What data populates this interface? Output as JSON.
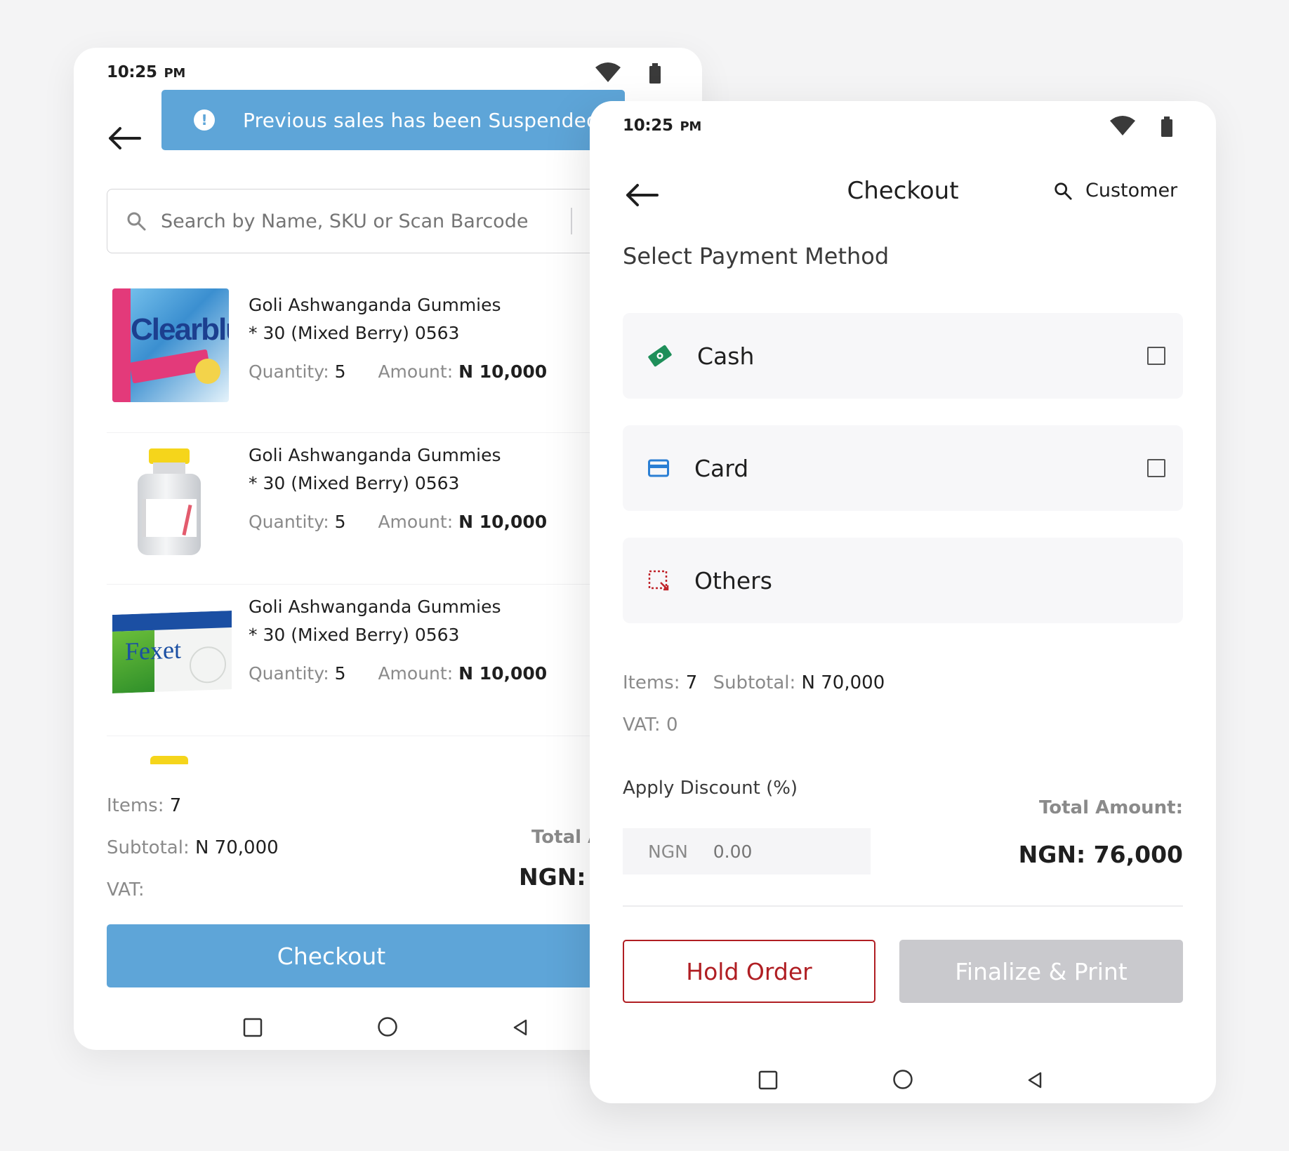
{
  "colors": {
    "accent_blue": "#5ea5d8",
    "hold_red": "#b01e23",
    "cash_green": "#1f8f5a",
    "card_blue": "#2b7fd4",
    "others_red": "#c0242b",
    "disabled_grey": "#c9c9cd"
  },
  "left": {
    "status": {
      "time": "10:25",
      "ampm": "PM"
    },
    "toast": {
      "icon": "info-icon",
      "text": "Previous sales has been Suspended"
    },
    "search": {
      "placeholder": "Search by Name, SKU or Scan Barcode"
    },
    "products": [
      {
        "name": "Goli Ashwanganda Gummies",
        "variant": "* 30 (Mixed Berry) 0563",
        "qty_label": "Quantity:",
        "qty": "5",
        "amount_label": "Amount:",
        "amount": "N 10,000",
        "image": "clearblue-box"
      },
      {
        "name": "Goli Ashwanganda Gummies",
        "variant": "* 30 (Mixed Berry) 0563",
        "qty_label": "Quantity:",
        "qty": "5",
        "amount_label": "Amount:",
        "amount": "N 10,000",
        "image": "vial"
      },
      {
        "name": "Goli Ashwanganda Gummies",
        "variant": "* 30 (Mixed Berry) 0563",
        "qty_label": "Quantity:",
        "qty": "5",
        "amount_label": "Amount:",
        "amount": "N 10,000",
        "image": "fexet-box"
      }
    ],
    "summary": {
      "items_label": "Items:",
      "items": "7",
      "subtotal_label": "Subtotal:",
      "subtotal": "N 70,000",
      "vat_label": "VAT:",
      "total_label": "Total A",
      "total_value": "NGN: '"
    },
    "checkout_button": "Checkout"
  },
  "right": {
    "status": {
      "time": "10:25",
      "ampm": "PM"
    },
    "title": "Checkout",
    "customer_label": "Customer",
    "section_title": "Select Payment Method",
    "methods": [
      {
        "label": "Cash",
        "icon": "cash-icon",
        "checked": false
      },
      {
        "label": "Card",
        "icon": "card-icon",
        "checked": false
      },
      {
        "label": "Others",
        "icon": "others-icon"
      }
    ],
    "summary": {
      "items_label": "Items:",
      "items": "7",
      "subtotal_label": "Subtotal:",
      "subtotal": "N 70,000",
      "vat_label": "VAT:",
      "vat": "0"
    },
    "discount": {
      "label": "Apply Discount (%)",
      "currency": "NGN",
      "placeholder": "0.00"
    },
    "total": {
      "label": "Total Amount:",
      "value": "NGN: 76,000"
    },
    "hold_button": "Hold Order",
    "finalize_button": "Finalize & Print"
  }
}
